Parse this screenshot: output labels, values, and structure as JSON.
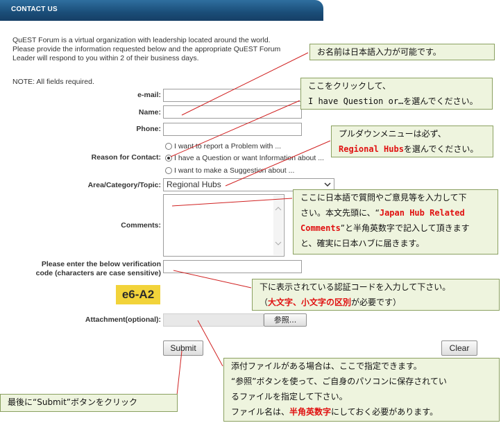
{
  "header": {
    "title": "CONTACT US"
  },
  "intro": {
    "line1": "QuEST Forum is a virtual organization with leadership located around the world.",
    "line2": "Please provide the information requested below and the appropriate QuEST Forum",
    "line3": "Leader will respond to you within 2 of their business days.",
    "note": "NOTE: All fields required."
  },
  "form": {
    "email_label": "e-mail:",
    "name_label": "Name:",
    "phone_label": "Phone:",
    "reason_label": "Reason for Contact:",
    "reason_options": [
      "I want to report a Problem with ...",
      "I have a Question or want Information about ...",
      "I want to make a Suggestion about ..."
    ],
    "reason_selected_index": 1,
    "area_label": "Area/Category/Topic:",
    "area_value": "Regional Hubs",
    "comments_label": "Comments:",
    "verify_label_1": "Please enter the below verification",
    "verify_label_2": "code (characters are case sensitive)",
    "captcha_code": "e6-A2",
    "attachment_label": "Attachment(optional):",
    "browse_label": "参照...",
    "submit_label": "Submit",
    "clear_label": "Clear"
  },
  "callouts": {
    "name": "お名前は日本語入力が可能です。",
    "question_1": "ここをクリックして、",
    "question_2": "I have Question or…を選んでください。",
    "dropdown_1": "プルダウンメニューは必ず、",
    "dropdown_2a": "Regional Hubs",
    "dropdown_2b": "を選んでください。",
    "comments_1": "ここに日本語で質問やご意見等を入力して下",
    "comments_2a": "さい。本文先頭に、“",
    "comments_2b": "Japan Hub Related",
    "comments_3a": "Comments",
    "comments_3b": "”と半角英数字で記入して頂きます",
    "comments_4": "と、確実に日本ハブに届きます。",
    "verify_1": "下に表示されている認証コードを入力して下さい。",
    "verify_2a": "（",
    "verify_2b": "大文字、小文字の区別",
    "verify_2c": "が必要です）",
    "attach_1": "添付ファイルがある場合は、ここで指定できます。",
    "attach_2": "“参照”ボタンを使って、ご自身のパソコンに保存されてい",
    "attach_3": "るファイルを指定して下さい。",
    "attach_4a": "ファイル名は、",
    "attach_4b": "半角英数字",
    "attach_4c": "にしておく必要があります。",
    "submit": "最後に“Submit”ボタンをクリック"
  },
  "colors": {
    "header_bg": "#1a4d78",
    "callout_bg": "#eef4de",
    "accent_red": "#e01010",
    "captcha_bg": "#f2d33a"
  }
}
